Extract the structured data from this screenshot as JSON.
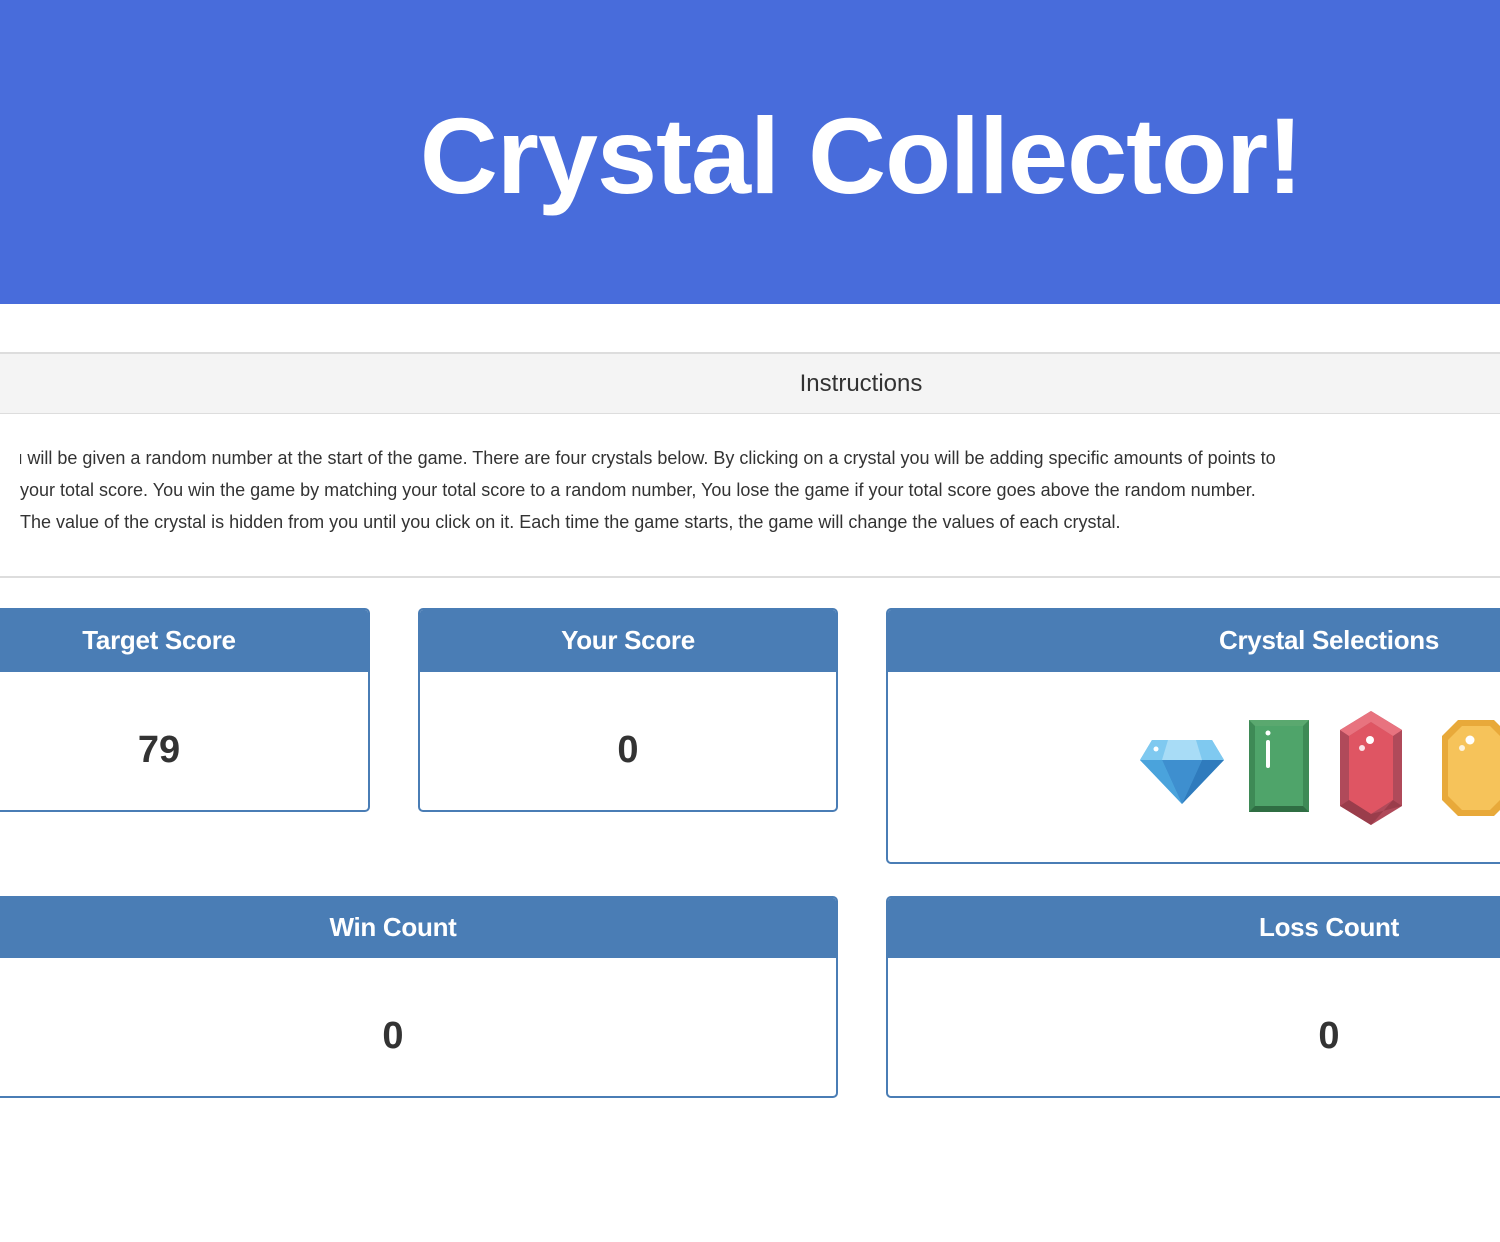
{
  "header": {
    "title": "Crystal Collector!"
  },
  "instructions": {
    "heading": "Instructions",
    "text": "You will be given a random number at the start of the game. There are four crystals below. By clicking on a crystal you will be adding specific amounts of points to your total score. You win the game by matching your total score to a random number, You lose the game if your total score goes above the random number. The value of the crystal is hidden from you until you click on it. Each time the game starts, the game will change the values of each crystal."
  },
  "target_score": {
    "label": "Target Score",
    "value": "79"
  },
  "your_score": {
    "label": "Your Score",
    "value": "0"
  },
  "crystal_selections": {
    "label": "Crystal Selections",
    "crystals": [
      "blue-diamond-crystal-icon",
      "green-emerald-crystal-icon",
      "red-ruby-crystal-icon",
      "yellow-topaz-crystal-icon"
    ]
  },
  "win_count": {
    "label": "Win Count",
    "value": "0"
  },
  "loss_count": {
    "label": "Loss Count",
    "value": "0"
  },
  "colors": {
    "header_bg": "#486cdb",
    "panel_accent": "#4a7db5",
    "instructions_bg": "#f4f4f4"
  }
}
